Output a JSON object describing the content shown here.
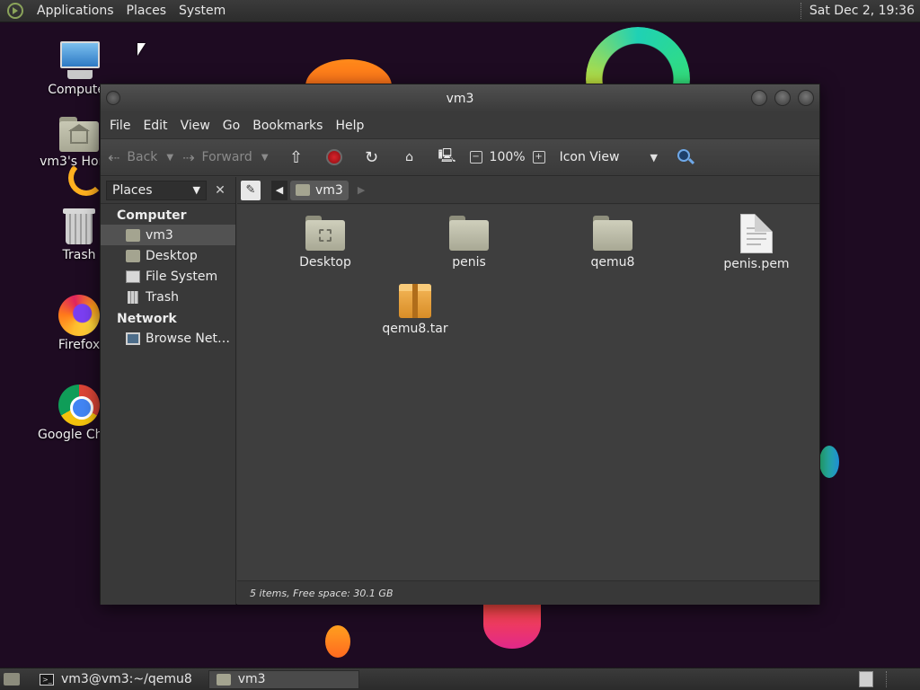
{
  "top_panel": {
    "menus": [
      "Applications",
      "Places",
      "System"
    ],
    "clock": "Sat Dec 2, 19:36"
  },
  "desktop": {
    "icons": [
      {
        "label": "Computer",
        "icon": "computer-icon"
      },
      {
        "label": "vm3's Home",
        "icon": "home-folder-icon"
      },
      {
        "label": "Trash",
        "icon": "trash-icon"
      },
      {
        "label": "Firefox",
        "icon": "firefox-icon"
      },
      {
        "label": "Google Chrome",
        "icon": "chrome-icon"
      }
    ]
  },
  "window": {
    "title": "vm3",
    "menubar": [
      "File",
      "Edit",
      "View",
      "Go",
      "Bookmarks",
      "Help"
    ],
    "toolbar": {
      "back_label": "Back",
      "forward_label": "Forward",
      "zoom": "100%",
      "view_mode": "Icon View"
    },
    "sidebar": {
      "selector": "Places",
      "groups": [
        {
          "name": "Computer",
          "items": [
            {
              "label": "vm3",
              "icon": "home-folder-icon",
              "selected": true
            },
            {
              "label": "Desktop",
              "icon": "folder-icon"
            },
            {
              "label": "File System",
              "icon": "drive-icon"
            },
            {
              "label": "Trash",
              "icon": "trash-icon"
            }
          ]
        },
        {
          "name": "Network",
          "items": [
            {
              "label": "Browse Net…",
              "icon": "network-icon"
            }
          ]
        }
      ]
    },
    "pathbar": {
      "current": "vm3"
    },
    "files": [
      {
        "name": "Desktop",
        "type": "folder"
      },
      {
        "name": "penis",
        "type": "folder"
      },
      {
        "name": "qemu8",
        "type": "folder"
      },
      {
        "name": "penis.pem",
        "type": "document"
      },
      {
        "name": "qemu8.tar",
        "type": "archive"
      }
    ],
    "status": "5 items, Free space: 30.1 GB"
  },
  "taskbar": {
    "tasks": [
      {
        "label": "vm3@vm3:~/qemu8",
        "icon": "terminal-icon",
        "active": false
      },
      {
        "label": "vm3",
        "icon": "folder-icon",
        "active": true
      }
    ]
  }
}
